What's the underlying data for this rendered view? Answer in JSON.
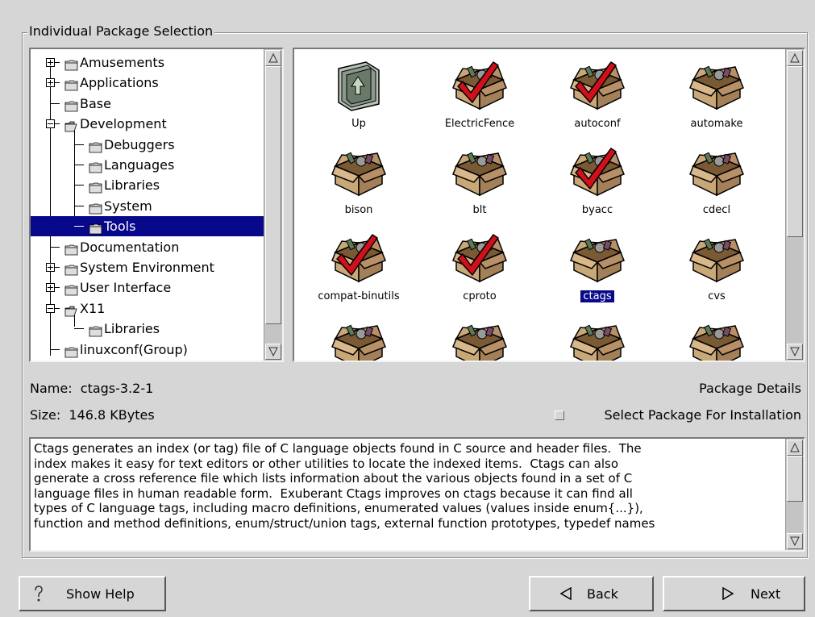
{
  "section": {
    "title": "Individual Package Selection"
  },
  "tree": {
    "items": [
      {
        "label": "Amusements",
        "expander": "plus"
      },
      {
        "label": "Applications",
        "expander": "plus"
      },
      {
        "label": "Base",
        "expander": "none"
      },
      {
        "label": "Development",
        "expander": "minus"
      },
      {
        "label": "Debuggers",
        "expander": "none"
      },
      {
        "label": "Languages",
        "expander": "none"
      },
      {
        "label": "Libraries",
        "expander": "none"
      },
      {
        "label": "System",
        "expander": "none"
      },
      {
        "label": "Tools",
        "expander": "none",
        "selected": true
      },
      {
        "label": "Documentation",
        "expander": "none"
      },
      {
        "label": "System Environment",
        "expander": "plus"
      },
      {
        "label": "User Interface",
        "expander": "plus"
      },
      {
        "label": "X11",
        "expander": "minus"
      },
      {
        "label": "Libraries",
        "expander": "none"
      },
      {
        "label": "linuxconf(Group)",
        "expander": "none"
      }
    ]
  },
  "packages": {
    "items": [
      {
        "label": "Up",
        "icon": "up-folder-icon",
        "checked": false
      },
      {
        "label": "ElectricFence",
        "icon": "package-checked-icon",
        "checked": true
      },
      {
        "label": "autoconf",
        "icon": "package-checked-icon",
        "checked": true
      },
      {
        "label": "automake",
        "icon": "package-icon",
        "checked": false
      },
      {
        "label": "bison",
        "icon": "package-icon",
        "checked": false
      },
      {
        "label": "blt",
        "icon": "package-icon",
        "checked": false
      },
      {
        "label": "byacc",
        "icon": "package-checked-icon",
        "checked": true
      },
      {
        "label": "cdecl",
        "icon": "package-icon",
        "checked": false
      },
      {
        "label": "compat-binutils",
        "icon": "package-checked-icon",
        "checked": true
      },
      {
        "label": "cproto",
        "icon": "package-checked-icon",
        "checked": true
      },
      {
        "label": "ctags",
        "icon": "package-icon",
        "checked": false,
        "selected": true
      },
      {
        "label": "cvs",
        "icon": "package-icon",
        "checked": false
      },
      {
        "label": "",
        "icon": "package-icon",
        "checked": false
      },
      {
        "label": "",
        "icon": "package-icon",
        "checked": false
      },
      {
        "label": "",
        "icon": "package-icon",
        "checked": false
      },
      {
        "label": "",
        "icon": "package-icon",
        "checked": false
      }
    ]
  },
  "details": {
    "name_label": "Name:",
    "name_value": "ctags-3.2-1",
    "size_label": "Size:",
    "size_value": "146.8 KBytes",
    "details_link": "Package Details",
    "select_label": "Select Package For Installation",
    "select_checked": false
  },
  "description": {
    "lines": [
      "Ctags generates an index (or tag) file of C language objects found in C source and header files.  The",
      "index makes it easy for text editors or other utilities to locate the indexed items.  Ctags can also",
      "generate a cross reference file which lists information about the various objects found in a set of C",
      "language files in human readable form.  Exuberant Ctags improves on ctags because it can find all",
      "types of C language tags, including macro definitions, enumerated values (values inside enum{...}),",
      "function and method definitions, enum/struct/union tags, external function prototypes, typedef names"
    ]
  },
  "buttons": {
    "help": "Show Help",
    "back": "Back",
    "next": "Next"
  },
  "colors": {
    "selection": "#08088a",
    "check": "#d0101a",
    "box": "#b08e60"
  }
}
